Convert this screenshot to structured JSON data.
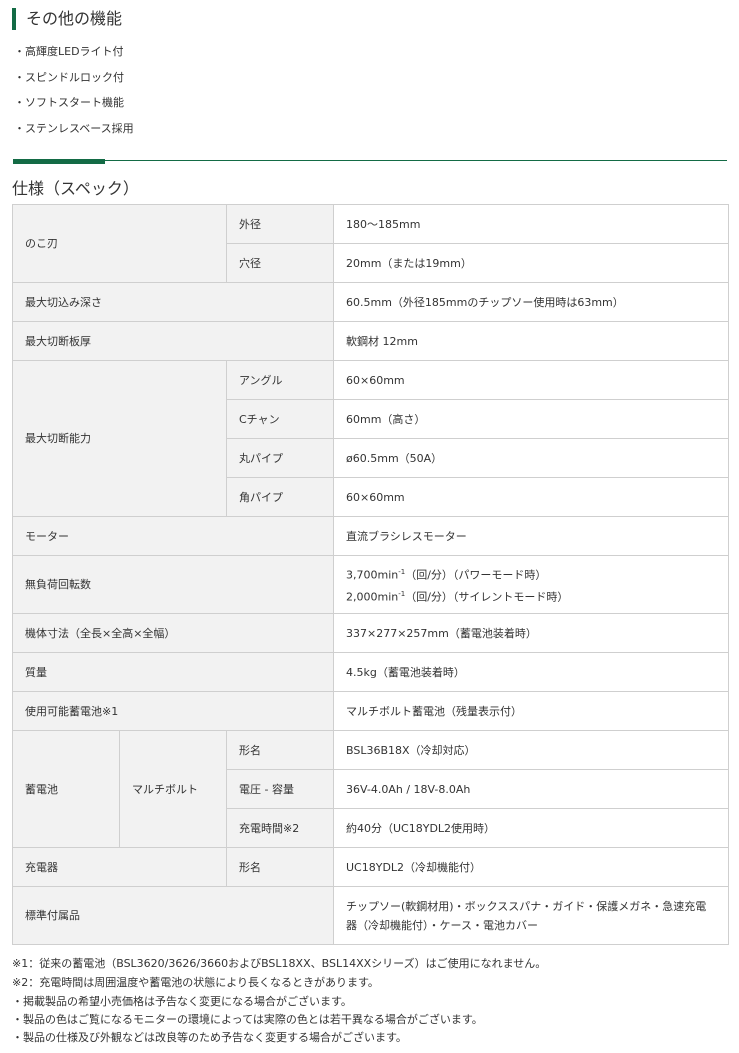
{
  "features": {
    "title": "その他の機能",
    "items": [
      "・高輝度LEDライト付",
      "・スピンドルロック付",
      "・ソフトスタート機能",
      "・ステンレスベース採用"
    ]
  },
  "spec": {
    "title": "仕様（スペック）",
    "blade": {
      "label": "のこ刃",
      "outer_label": "外径",
      "outer": "180～185mm",
      "bore_label": "穴径",
      "bore": "20mm（または19mm）"
    },
    "depth": {
      "label": "最大切込み深さ",
      "value": "60.5mm（外径185mmのチップソー使用時は63mm）"
    },
    "plate": {
      "label": "最大切断板厚",
      "value": "軟鋼材 12mm"
    },
    "capacity": {
      "label": "最大切断能力",
      "rows": [
        {
          "label": "アングル",
          "value": "60×60mm"
        },
        {
          "label": "Cチャン",
          "value": "60mm（高さ）"
        },
        {
          "label": "丸パイプ",
          "value": "ø60.5mm（50A）"
        },
        {
          "label": "角パイプ",
          "value": "60×60mm"
        }
      ]
    },
    "motor": {
      "label": "モーター",
      "value": "直流ブラシレスモーター"
    },
    "speed": {
      "label": "無負荷回転数",
      "line1_a": "3,700min",
      "line1_b": "（回/分）（パワーモード時）",
      "line2_a": "2,000min",
      "line2_b": "（回/分）（サイレントモード時）",
      "sup": "-1"
    },
    "dims": {
      "label": "機体寸法（全長×全高×全幅）",
      "value": "337×277×257mm（蓄電池装着時）"
    },
    "mass": {
      "label": "質量",
      "value": "4.5kg（蓄電池装着時）"
    },
    "usable_battery": {
      "label": "使用可能蓄電池※1",
      "value": "マルチボルト蓄電池（残量表示付）"
    },
    "battery": {
      "label": "蓄電池",
      "type": "マルチボルト",
      "rows": [
        {
          "label": "形名",
          "value": "BSL36B18X（冷却対応）"
        },
        {
          "label": "電圧 - 容量",
          "value": "36V-4.0Ah / 18V-8.0Ah"
        },
        {
          "label": "充電時間※2",
          "value": "約40分（UC18YDL2使用時）"
        }
      ]
    },
    "charger": {
      "label": "充電器",
      "sub": "形名",
      "value": "UC18YDL2（冷却機能付）"
    },
    "accessories": {
      "label": "標準付属品",
      "value": "チップソー(軟鋼材用)・ボックススパナ・ガイド・保護メガネ・急速充電器（冷却機能付）・ケース・電池カバー"
    }
  },
  "notes": [
    "※1：従来の蓄電池（BSL3620/3626/3660およびBSL18XX、BSL14XXシリーズ）はご使用になれません。",
    "※2：充電時間は周囲温度や蓄電池の状態により長くなるときがあります。"
  ],
  "disclaimers": [
    "・掲載製品の希望小売価格は予告なく変更になる場合がございます。",
    "・製品の色はご覧になるモニターの環境によっては実際の色とは若干異なる場合がございます。",
    "・製品の仕様及び外観などは改良等のため予告なく変更する場合がございます。"
  ]
}
